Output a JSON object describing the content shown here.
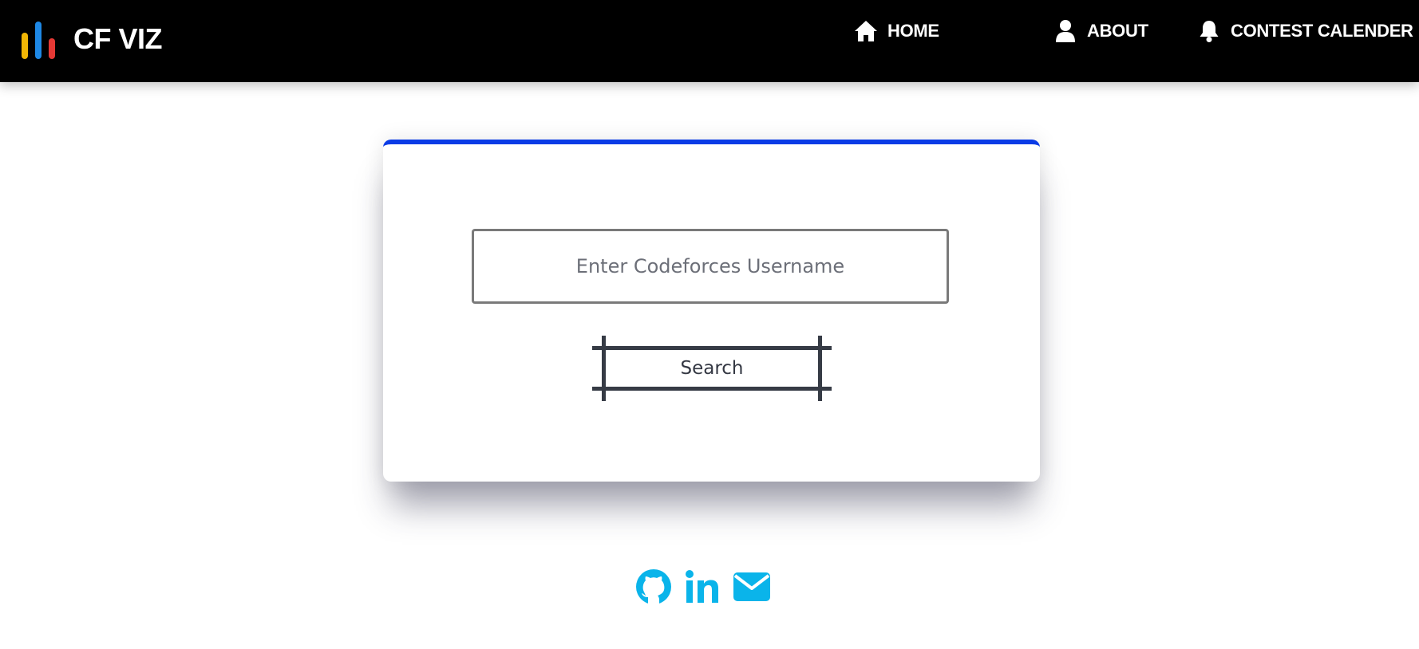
{
  "brand": {
    "name": "CF VIZ",
    "logo_icon": "bar-chart-icon",
    "logo_colors": [
      "#f2b705",
      "#1e88e5",
      "#e53935"
    ]
  },
  "nav": {
    "items": [
      {
        "label": "HOME",
        "icon": "home-icon"
      },
      {
        "label": "ABOUT",
        "icon": "user-icon"
      },
      {
        "label": "CONTEST CALENDER",
        "icon": "bell-icon"
      }
    ]
  },
  "search": {
    "placeholder": "Enter Codeforces Username",
    "value": "",
    "button_label": "Search"
  },
  "socials": [
    {
      "name": "github",
      "icon": "github-icon"
    },
    {
      "name": "linkedin",
      "icon": "linkedin-icon"
    },
    {
      "name": "email",
      "icon": "mail-icon"
    }
  ],
  "colors": {
    "navbar_bg": "#000000",
    "accent": "#0a3be6",
    "social": "#0ab4ea",
    "button": "#363b45"
  }
}
